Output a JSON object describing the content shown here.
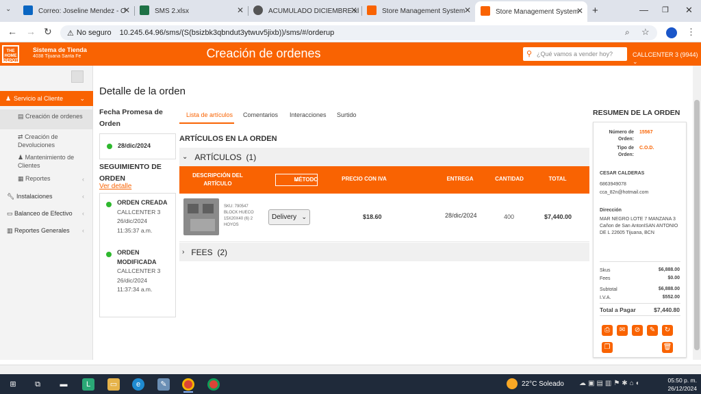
{
  "browser": {
    "tabs": [
      {
        "label": "Correo: Joseline Mendez - O",
        "color": "#0a66c2"
      },
      {
        "label": "SMS 2.xlsx",
        "color": "#1e7145"
      },
      {
        "label": "ACUMULADO DICIEMBRE.xl",
        "color": "#555555"
      },
      {
        "label": "Store Management System",
        "color": "#f96302"
      },
      {
        "label": "Store Management System",
        "color": "#f96302"
      }
    ],
    "not_secure": "No seguro",
    "url": "10.245.64.96/sms/(S(bsizbk3qbndut3ytwuv5jixb))/sms/#/orderup"
  },
  "header": {
    "store_name": "Sistema de Tienda",
    "store_sub": "4038 Tijuana Santa Fe",
    "title": "Creación de ordenes",
    "search_placeholder": "¿Qué vamos a vender hoy?",
    "callcenter": "CALLCENTER 3 (9944)",
    "brand_color": "#f96302"
  },
  "sidebar": {
    "service": "Servicio al Cliente",
    "subs": [
      "Creación de ordenes",
      "Creación de Devoluciones",
      "Mantenimiento de Clientes",
      "Reportes"
    ],
    "items": [
      "Instalaciones",
      "Balanceo de Efectivo",
      "Reportes Generales"
    ]
  },
  "order": {
    "title": "Detalle de la orden",
    "promise_label": "Fecha Promesa de Orden",
    "promise_date": "28/dic/2024",
    "tracking_label": "SEGUIMIENTO DE ORDEN",
    "detail_link": "Ver detalle",
    "timeline": [
      {
        "status": "ORDEN CREADA",
        "user": "CALLCENTER 3",
        "date": "26/dic/2024",
        "time": "11:35:37 a.m."
      },
      {
        "status": "ORDEN MODIFICADA",
        "user": "CALLCENTER 3",
        "date": "26/dic/2024",
        "time": "11:37:34 a.m."
      }
    ],
    "tabs": [
      "Lista de artículos",
      "Comentarios",
      "Interacciones",
      "Surtido"
    ],
    "items_heading": "ARTÍCULOS EN LA ORDEN",
    "articles_label": "ARTÍCULOS",
    "articles_count": "(1)",
    "columns": {
      "desc": "DESCRIPCIÓN DEL ARTÍCULO",
      "method": "MÉTODO",
      "price": "PRECIO CON IVA",
      "delivery": "ENTREGA",
      "qty": "CANTIDAD",
      "total": "TOTAL"
    },
    "row": {
      "sku": "SKU: 790547",
      "desc": "BLOCK HUECO 15X20X40 (6) 2 HOYOS",
      "method": "Delivery",
      "price": "$18.60",
      "delivery": "28/dic/2024",
      "qty": "400",
      "total": "$7,440.00"
    },
    "fees_label": "FEES",
    "fees_count": "(2)"
  },
  "summary": {
    "heading": "RESUMEN DE LA ORDEN",
    "order_no_label": "Número de Orden:",
    "order_no": "15567",
    "type_label": "Tipo de Orden:",
    "type": "C.O.D.",
    "customer": "CESAR CALDERAS",
    "phone": "6863949078",
    "email": "cca_82n@hotmail.com",
    "address_label": "Dirección",
    "address": "MAR NEGRO LOTE 7 MANZANA 3 Cañon de San AntonISAN ANTONIO DE L 22605 Tijuana, BCN",
    "lines": [
      {
        "label": "Skus",
        "value": "$6,888.00"
      },
      {
        "label": "Fees",
        "value": "$0.00"
      },
      {
        "label": "Subtotal",
        "value": "$6,888.00"
      },
      {
        "label": "I.V.A.",
        "value": "$552.00"
      }
    ],
    "total_label": "Total a Pagar",
    "total": "$7,440.80"
  },
  "taskbar": {
    "weather": "22°C Soleado",
    "time": "05:50 p. m.",
    "date": "26/12/2024"
  }
}
